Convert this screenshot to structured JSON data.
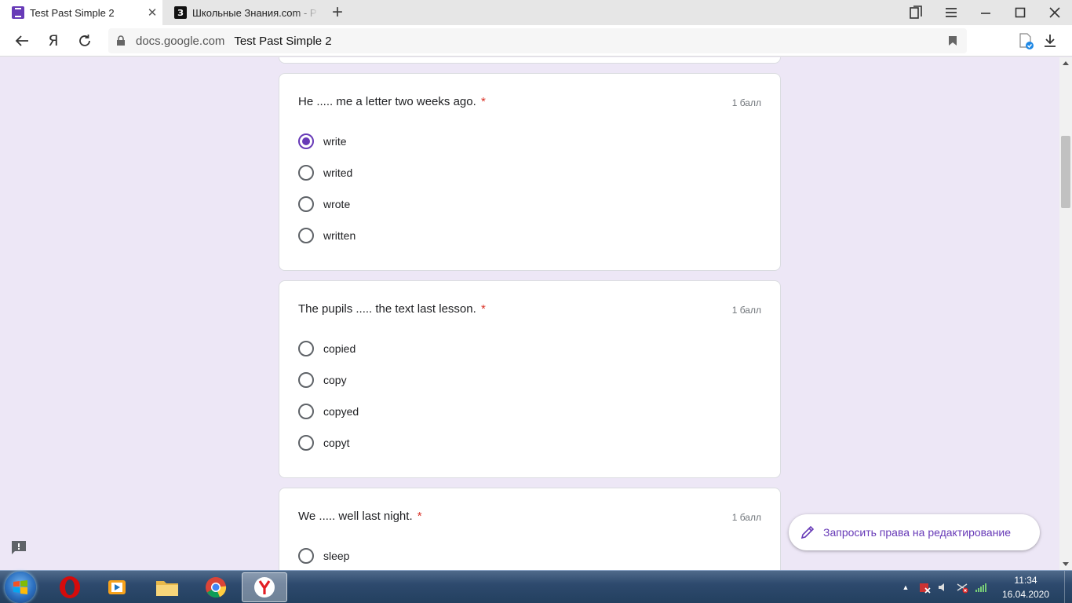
{
  "browser": {
    "tabs": [
      {
        "title": "Test Past Simple 2",
        "active": true
      },
      {
        "title": "Школьные Знания.com - Р",
        "active": false
      }
    ],
    "favicon_znania_letter": "З",
    "address": {
      "domain": "docs.google.com",
      "page_title": "Test Past Simple 2"
    }
  },
  "form": {
    "questions": [
      {
        "text": "He ..... me a letter two weeks ago.",
        "required_mark": "*",
        "points": "1 балл",
        "options": [
          "write",
          "writed",
          "wrote",
          "written"
        ],
        "selected": 0
      },
      {
        "text": "The pupils ..... the text last lesson.",
        "required_mark": "*",
        "points": "1 балл",
        "options": [
          "copied",
          "copy",
          "copyed",
          "copyt"
        ],
        "selected": null
      },
      {
        "text": "We ..... well last night.",
        "required_mark": "*",
        "points": "1 балл",
        "options": [
          "sleep"
        ],
        "selected": null
      }
    ],
    "request_edit_label": "Запросить права на редактирование"
  },
  "taskbar": {
    "clock_time": "11:34",
    "clock_date": "16.04.2020"
  },
  "colors": {
    "accent": "#673ab7",
    "page_bg": "#ede7f6",
    "required": "#d93025"
  }
}
